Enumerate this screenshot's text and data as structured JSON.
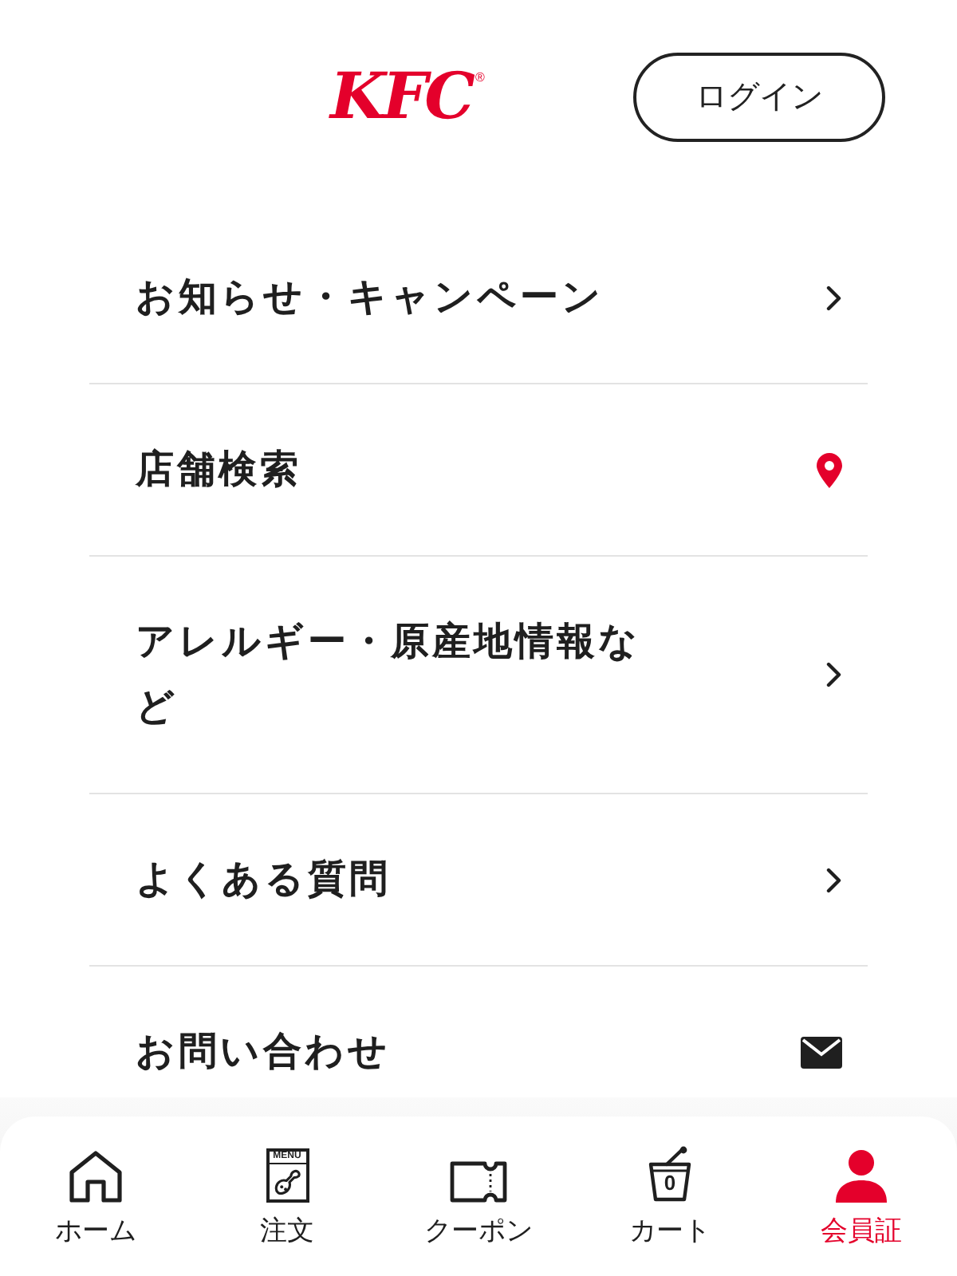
{
  "header": {
    "logo": {
      "text": "KFC",
      "mark": "®"
    },
    "login_button": "ログイン"
  },
  "menu": [
    {
      "label": "お知らせ・キャンペーン",
      "kind": "chevron"
    },
    {
      "label": "店舗検索",
      "kind": "pin"
    },
    {
      "label": "アレルギー・原産地情報など",
      "kind": "chevron"
    },
    {
      "label": "よくある質問",
      "kind": "chevron"
    },
    {
      "label": "お問い合わせ",
      "kind": "mail"
    }
  ],
  "tab_bar": [
    {
      "label": "ホーム",
      "kind": "home",
      "selected": false
    },
    {
      "label": "注文",
      "kind": "menu",
      "icon_text": "MENU",
      "selected": false
    },
    {
      "label": "クーポン",
      "kind": "coupon",
      "selected": false
    },
    {
      "label": "カート",
      "kind": "cart",
      "badge": "0",
      "selected": false
    },
    {
      "label": "会員証",
      "kind": "member",
      "selected": true
    }
  ]
}
